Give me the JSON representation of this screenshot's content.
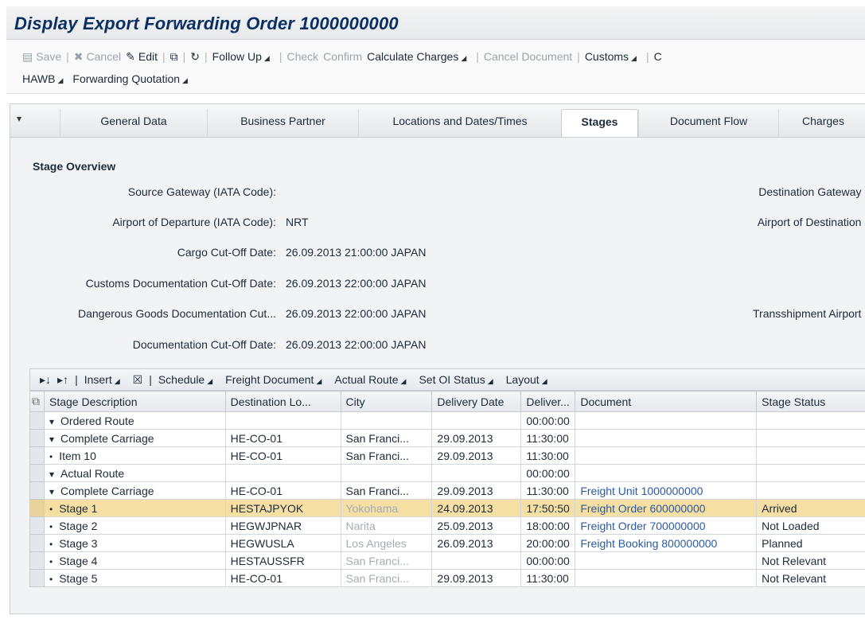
{
  "window": {
    "title": "Display Export Forwarding Order 1000000000"
  },
  "toolbar": {
    "row1": [
      {
        "label": "Save",
        "icon": "save-icon",
        "disabled": true
      },
      {
        "sep": true
      },
      {
        "label": "Cancel",
        "icon": "cancel-icon",
        "disabled": true
      },
      {
        "label": "Edit",
        "icon": "pencil-icon",
        "disabled": false
      },
      {
        "sep": true
      },
      {
        "label": "",
        "icon": "copy-icon",
        "disabled": false
      },
      {
        "sep": true
      },
      {
        "label": "",
        "icon": "refresh-icon",
        "disabled": false
      },
      {
        "sep": true
      },
      {
        "label": "Follow Up",
        "dropdown": true,
        "disabled": false
      },
      {
        "sep": true
      },
      {
        "label": "Check",
        "disabled": true
      },
      {
        "label": "Confirm",
        "disabled": true
      },
      {
        "label": "Calculate Charges",
        "dropdown": true,
        "disabled": false
      },
      {
        "sep": true
      },
      {
        "label": "Cancel Document",
        "disabled": true
      },
      {
        "sep": true
      },
      {
        "label": "Customs",
        "dropdown": true,
        "disabled": false
      },
      {
        "sep": true
      },
      {
        "label": "C",
        "disabled": false
      }
    ],
    "row2": [
      {
        "label": "HAWB",
        "dropdown": true
      },
      {
        "label": "Forwarding Quotation",
        "dropdown": true
      }
    ]
  },
  "tabs": [
    {
      "label": "General Data",
      "active": false
    },
    {
      "label": "Business Partner",
      "active": false
    },
    {
      "label": "Locations and Dates/Times",
      "active": false
    },
    {
      "label": "Stages",
      "active": true
    },
    {
      "label": "Document Flow",
      "active": false
    },
    {
      "label": "Charges",
      "active": false
    }
  ],
  "stage_overview": {
    "title": "Stage Overview",
    "left_fields": [
      {
        "label": "Source Gateway (IATA Code):",
        "value": ""
      },
      {
        "label": "Airport of Departure (IATA Code):",
        "value": "NRT"
      },
      {
        "label": "Cargo Cut-Off Date:",
        "value": "26.09.2013 21:00:00 JAPAN"
      },
      {
        "label": "Customs Documentation Cut-Off Date:",
        "value": "26.09.2013 22:00:00 JAPAN"
      },
      {
        "label": "Dangerous Goods Documentation Cut...",
        "value": "26.09.2013 22:00:00 JAPAN"
      },
      {
        "label": "Documentation Cut-Off Date:",
        "value": "26.09.2013 22:00:00 JAPAN"
      }
    ],
    "right_fields": [
      {
        "label": "Destination Gateway ("
      },
      {
        "label": "Airport of Destination ("
      },
      {
        "label": "Transshipment Airport ("
      }
    ]
  },
  "table_toolbar": {
    "items": [
      {
        "label": "",
        "icon": "expand-all-icon"
      },
      {
        "label": "",
        "icon": "collapse-all-icon"
      },
      {
        "sep": true
      },
      {
        "label": "Insert",
        "dropdown": true
      },
      {
        "label": "",
        "icon": "delete-icon"
      },
      {
        "sep": true
      },
      {
        "label": "Schedule",
        "dropdown": true
      },
      {
        "label": "Freight Document",
        "dropdown": true
      },
      {
        "label": "Actual Route",
        "dropdown": true
      },
      {
        "label": "Set OI Status",
        "dropdown": true
      },
      {
        "label": "Layout",
        "dropdown": true
      }
    ]
  },
  "table": {
    "columns": [
      "Stage Description",
      "Destination Lo...",
      "City",
      "Delivery Date",
      "Deliver...",
      "Document",
      "Stage Status"
    ],
    "rows": [
      {
        "level": 1,
        "toggle": "▾",
        "desc": "Ordered Route",
        "dest": "",
        "city": "",
        "date": "",
        "time": "00:00:00",
        "doc": "",
        "status": "",
        "muted_city": false,
        "highlight": false
      },
      {
        "level": 2,
        "toggle": "▾",
        "desc": "Complete Carriage",
        "dest": "HE-CO-01",
        "city": "San Franci...",
        "date": "29.09.2013",
        "time": "11:30:00",
        "doc": "",
        "status": "",
        "muted_city": false,
        "highlight": false
      },
      {
        "level": 3,
        "toggle": "•",
        "desc": "Item 10",
        "dest": "HE-CO-01",
        "city": "San Franci...",
        "date": "29.09.2013",
        "time": "11:30:00",
        "doc": "",
        "status": "",
        "muted_city": false,
        "highlight": false
      },
      {
        "level": 1,
        "toggle": "▾",
        "desc": "Actual Route",
        "dest": "",
        "city": "",
        "date": "",
        "time": "00:00:00",
        "doc": "",
        "status": "",
        "muted_city": false,
        "highlight": false
      },
      {
        "level": 2,
        "toggle": "▾",
        "desc": "Complete Carriage",
        "dest": "HE-CO-01",
        "city": "San Franci...",
        "date": "29.09.2013",
        "time": "11:30:00",
        "doc": "Freight Unit 1000000000",
        "status": "",
        "muted_city": false,
        "highlight": false
      },
      {
        "level": 3,
        "toggle": "•",
        "desc": "Stage 1",
        "dest": "HESTAJPYOK",
        "city": "Yokohama",
        "date": "24.09.2013",
        "time": "17:50:50",
        "doc": "Freight Order 600000000",
        "status": "Arrived",
        "muted_city": true,
        "highlight": true
      },
      {
        "level": 3,
        "toggle": "•",
        "desc": "Stage 2",
        "dest": "HEGWJPNAR",
        "city": "Narita",
        "date": "25.09.2013",
        "time": "18:00:00",
        "doc": "Freight Order 700000000",
        "status": "Not Loaded",
        "muted_city": true,
        "highlight": false
      },
      {
        "level": 3,
        "toggle": "•",
        "desc": "Stage 3",
        "dest": "HEGWUSLA",
        "city": "Los Angeles",
        "date": "26.09.2013",
        "time": "20:00:00",
        "doc": "Freight Booking 800000000",
        "status": "Planned",
        "muted_city": true,
        "highlight": false
      },
      {
        "level": 3,
        "toggle": "•",
        "desc": "Stage 4",
        "dest": "HESTAUSSFR",
        "city": "San Franci...",
        "date": "",
        "time": "00:00:00",
        "doc": "",
        "status": "Not Relevant",
        "muted_city": true,
        "highlight": false
      },
      {
        "level": 3,
        "toggle": "•",
        "desc": "Stage 5",
        "dest": "HE-CO-01",
        "city": "San Franci...",
        "date": "29.09.2013",
        "time": "11:30:00",
        "doc": "",
        "status": "Not Relevant",
        "muted_city": true,
        "highlight": false
      }
    ]
  }
}
